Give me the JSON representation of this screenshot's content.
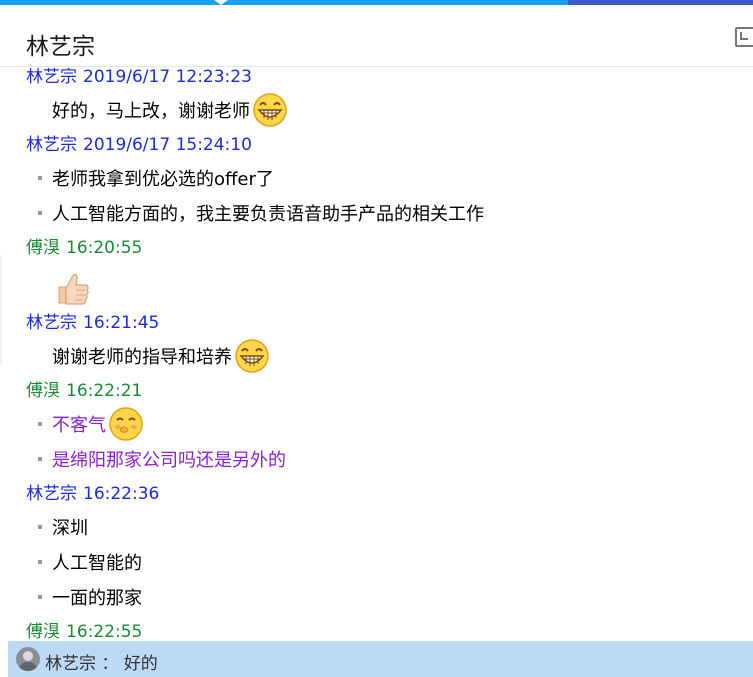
{
  "header": {
    "title": "林艺宗"
  },
  "messages": [
    {
      "sender": "林艺宗",
      "time": "2019/6/17 12:23:23",
      "color": "blue",
      "lines": [
        {
          "type": "plain",
          "text": "好的，马上改，谢谢老师",
          "emoji": "grin-emoji"
        }
      ]
    },
    {
      "sender": "林艺宗",
      "time": "2019/6/17 15:24:10",
      "color": "blue",
      "lines": [
        {
          "type": "bullet",
          "text": "老师我拿到优必选的offer了"
        },
        {
          "type": "bullet",
          "text": "人工智能方面的，我主要负责语音助手产品的相关工作"
        }
      ]
    },
    {
      "sender": "傅湨",
      "time": "16:20:55",
      "color": "green",
      "lines": [
        {
          "type": "emoji",
          "emoji": "thumbs-up-emoji"
        }
      ]
    },
    {
      "sender": "林艺宗",
      "time": "16:21:45",
      "color": "blue",
      "lines": [
        {
          "type": "plain",
          "text": "谢谢老师的指导和培养",
          "emoji": "grin-emoji"
        }
      ]
    },
    {
      "sender": "傅湨",
      "time": "16:22:21",
      "color": "green",
      "lines": [
        {
          "type": "bullet",
          "text": "不客气",
          "emoji": "shy-emoji",
          "purple": true
        },
        {
          "type": "bullet",
          "text": "是绵阳那家公司吗还是另外的",
          "purple": true
        }
      ]
    },
    {
      "sender": "林艺宗",
      "time": "16:22:36",
      "color": "blue",
      "lines": [
        {
          "type": "bullet",
          "text": "深圳"
        },
        {
          "type": "bullet",
          "text": "人工智能的"
        },
        {
          "type": "bullet",
          "text": "一面的那家"
        }
      ]
    },
    {
      "sender": "傅湨",
      "time": "16:22:55",
      "color": "green",
      "lines": []
    }
  ],
  "status_bar": {
    "sender": "林艺宗",
    "separator": "：",
    "text": "好的"
  },
  "colors": {
    "sender_blue": "#1b2bd6",
    "sender_green": "#178a34",
    "purple_text": "#8b20d8",
    "status_bg": "#bcd9f5"
  }
}
